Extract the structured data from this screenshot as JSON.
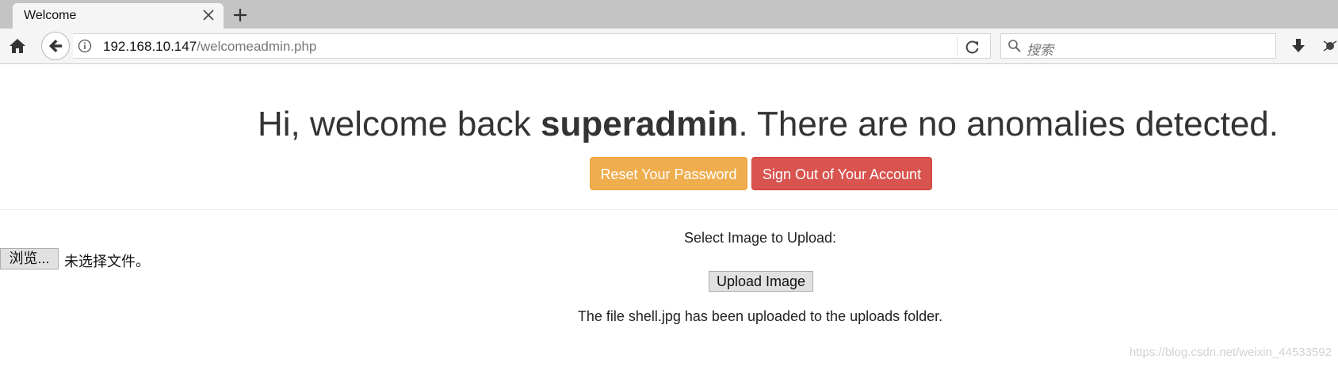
{
  "browser": {
    "tab_title": "Welcome",
    "url_host": "192.168.10.147",
    "url_path": "/welcomeadmin.php",
    "search_placeholder": "搜索"
  },
  "page": {
    "welcome_prefix": "Hi, welcome back ",
    "username": "superadmin",
    "welcome_suffix": ". There are no anomalies detected.",
    "reset_button": "Reset Your Password",
    "signout_button": "Sign Out of Your Account",
    "upload_label": "Select Image to Upload:",
    "browse_button": "浏览...",
    "file_status": "未选择文件。",
    "upload_button": "Upload Image",
    "message": "The file shell.jpg has been uploaded to the uploads folder."
  },
  "watermark": "https://blog.csdn.net/weixin_44533592",
  "colors": {
    "warning": "#f0ad4e",
    "danger": "#d9534f"
  }
}
